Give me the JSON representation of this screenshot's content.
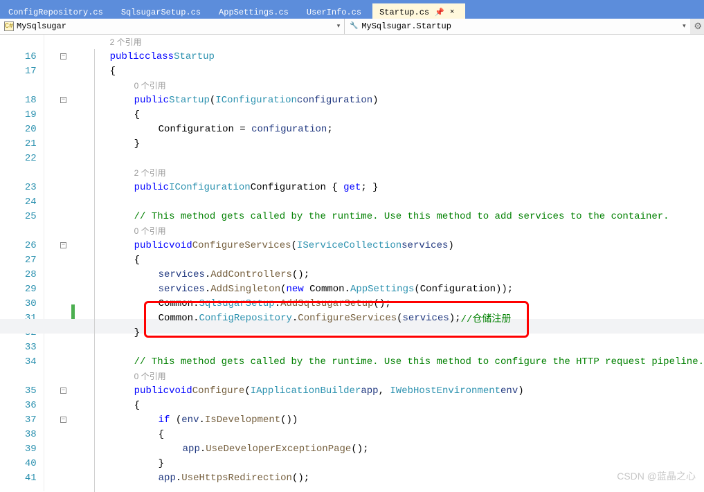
{
  "tabs": {
    "items": [
      {
        "label": "ConfigRepository.cs",
        "active": false
      },
      {
        "label": "SqlsugarSetup.cs",
        "active": false
      },
      {
        "label": "AppSettings.cs",
        "active": false
      },
      {
        "label": "UserInfo.cs",
        "active": false
      },
      {
        "label": "Startup.cs",
        "active": true
      }
    ],
    "pin": "📌",
    "close": "×"
  },
  "nav": {
    "left_icon": "C#",
    "left_text": "MySqlsugar",
    "right_icon": "🔧",
    "right_text": "MySqlsugar.Startup",
    "gear": "⚙"
  },
  "gutter_numbers": [
    "",
    "16",
    "17",
    "",
    "18",
    "19",
    "20",
    "21",
    "22",
    "",
    "23",
    "24",
    "25",
    "",
    "26",
    "27",
    "28",
    "29",
    "30",
    "31",
    "32",
    "33",
    "34",
    "",
    "35",
    "36",
    "37",
    "38",
    "39",
    "40",
    "41"
  ],
  "refs": {
    "two": "2 个引用",
    "zero": "0 个引用"
  },
  "code": {
    "l16": {
      "public": "public",
      "cls": "class",
      "startup": "Startup"
    },
    "l17": "{",
    "l18": {
      "public": "public",
      "ctor": "Startup",
      "iconf": "IConfiguration",
      "param": "configuration",
      "open": "(",
      "close": ")"
    },
    "l19": "{",
    "l20": {
      "conf": "Configuration",
      "eq": " = ",
      "param": "configuration",
      ";": ";"
    },
    "l21": "}",
    "l23": {
      "public": "public",
      "iconf": "IConfiguration",
      "conf": "Configuration",
      "rest": " { ",
      "get": "get",
      "tail": "; }"
    },
    "l25": "// This method gets called by the runtime. Use this method to add services to the container.",
    "l26": {
      "public": "public",
      "void": "void",
      "m": "ConfigureServices",
      "isc": "IServiceCollection",
      "p": "services",
      "open": "(",
      "close": ")"
    },
    "l27": "{",
    "l28": {
      "s": "services",
      "dot": ".",
      "m": "AddControllers",
      "tail": "();"
    },
    "l29": {
      "s": "services",
      "dot": ".",
      "m": "AddSingleton",
      "open": "(",
      "new": "new",
      "common": " Common.",
      "app": "AppSettings",
      "open2": "(",
      "conf": "Configuration",
      "close": "));"
    },
    "l30": {
      "common": "Common.",
      "setup": "SqlsugarSetup",
      "dot": ".",
      "m": "AddSqlsugarSetup",
      "tail": "();"
    },
    "l31": {
      "common": "Common.",
      "repo": "ConfigRepository",
      "dot": ".",
      "m": "ConfigureServices",
      "open": "(",
      "p": "services",
      "close": ");",
      "cmt": "//仓储注册"
    },
    "l32": "}",
    "l34": "// This method gets called by the runtime. Use this method to configure the HTTP request pipeline.",
    "l35": {
      "public": "public",
      "void": "void",
      "m": "Configure",
      "iab": "IApplicationBuilder",
      "p1": "app",
      "sep": ", ",
      "iwhe": "IWebHostEnvironment",
      "p2": "env",
      "open": "(",
      "close": ")"
    },
    "l36": "{",
    "l37": {
      "if": "if",
      "open": " (",
      "env": "env",
      "dot": ".",
      "m": "IsDevelopment",
      "tail": "())"
    },
    "l38": "{",
    "l39": {
      "app": "app",
      "dot": ".",
      "m": "UseDeveloperExceptionPage",
      "tail": "();"
    },
    "l40": "}",
    "l41": {
      "app": "app",
      "dot": ".",
      "m": "UseHttpsRedirection",
      "tail": "();"
    }
  },
  "watermark": "CSDN @蓝晶之心"
}
